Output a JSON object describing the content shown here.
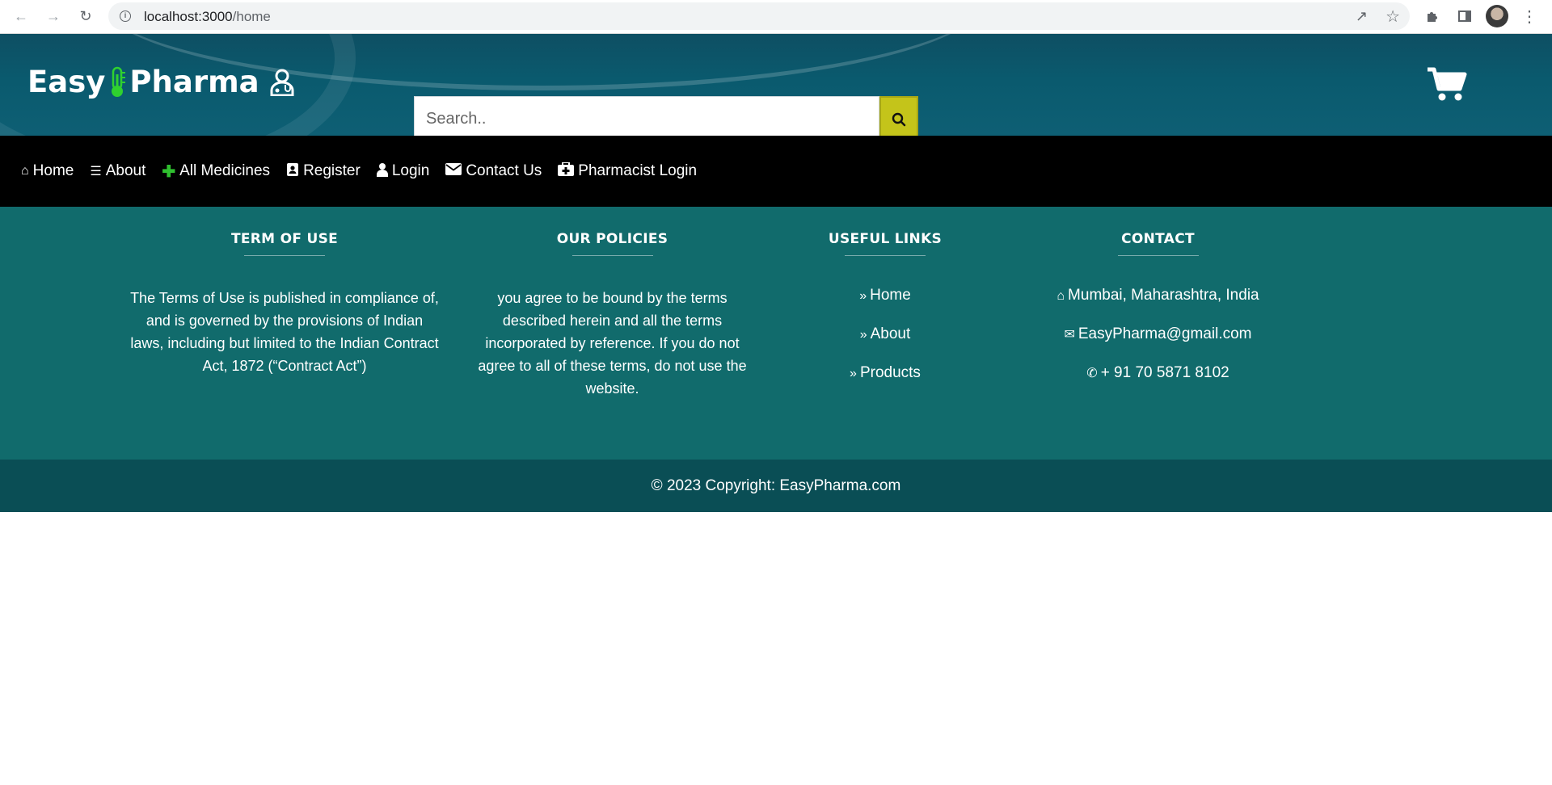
{
  "browser": {
    "url_host": "localhost:3000",
    "url_path": "/home"
  },
  "header": {
    "logo_left": "Easy",
    "logo_right": "Pharma",
    "search_placeholder": "Search..",
    "search_value": ""
  },
  "nav": {
    "items": [
      {
        "label": "Home",
        "icon": "home-icon"
      },
      {
        "label": "About",
        "icon": "list-icon"
      },
      {
        "label": "All Medicines",
        "icon": "plus-icon"
      },
      {
        "label": "Register",
        "icon": "address-book-icon"
      },
      {
        "label": "Login",
        "icon": "user-icon"
      },
      {
        "label": "Contact Us",
        "icon": "envelope-icon"
      },
      {
        "label": "Pharmacist Login",
        "icon": "medkit-icon"
      }
    ]
  },
  "footer": {
    "terms": {
      "heading": "TERM OF USE",
      "text": "The Terms of Use is published in compliance of, and is governed by the provisions of Indian laws, including but limited to the Indian Contract Act, 1872 (“Contract Act”)"
    },
    "policies": {
      "heading": "OUR POLICIES",
      "text": "you agree to be bound by the terms described herein and all the terms incorporated by reference. If you do not agree to all of these terms, do not use the website."
    },
    "links": {
      "heading": "USEFUL LINKS",
      "items": [
        "Home",
        "About",
        "Products"
      ]
    },
    "contact": {
      "heading": "CONTACT",
      "address": "Mumbai, Maharashtra, India",
      "email": "EasyPharma@gmail.com",
      "phone": "+ 91 70 5871 8102"
    },
    "copyright": "© 2023 Copyright: EasyPharma.com"
  },
  "colors": {
    "header_bg": "#0e5a6e",
    "nav_bg": "#000000",
    "footer_bg": "#116b6c",
    "copyright_bg": "#0a4e55",
    "search_button": "#c4c41a",
    "logo_accent": "#2fd12f"
  }
}
